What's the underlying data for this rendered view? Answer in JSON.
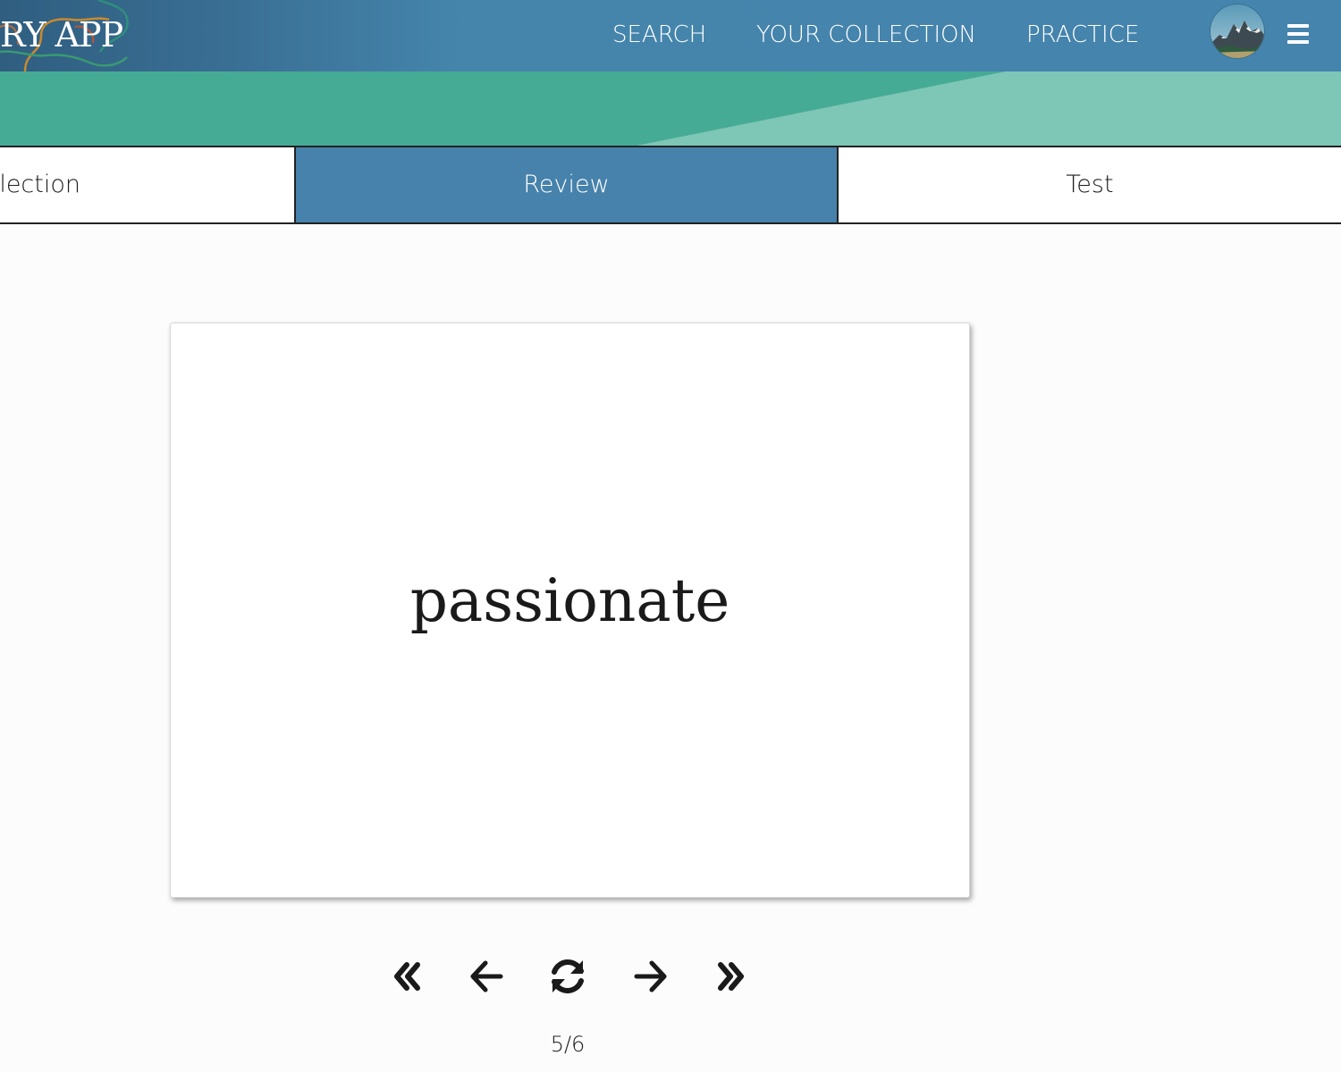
{
  "header": {
    "logo_text": "RY APP",
    "nav": {
      "search": "SEARCH",
      "collection": "YOUR COLLECTION",
      "practice": "PRACTICE"
    },
    "avatar_icon": "mountain-avatar-icon",
    "menu_icon": "hamburger-menu-icon"
  },
  "tabs": {
    "collection": "llection",
    "review": "Review",
    "test": "Test",
    "active": "review"
  },
  "card": {
    "word": "passionate"
  },
  "controls": {
    "first_icon": "double-chevron-left-icon",
    "prev_icon": "arrow-left-icon",
    "flip_icon": "refresh-icon",
    "next_icon": "arrow-right-icon",
    "last_icon": "double-chevron-right-icon"
  },
  "counter": "5/6",
  "colors": {
    "header_blue": "#4584ac",
    "teal_dark": "#46ab95",
    "teal_light": "#7ec6b5",
    "active_tab": "#4682ab"
  }
}
